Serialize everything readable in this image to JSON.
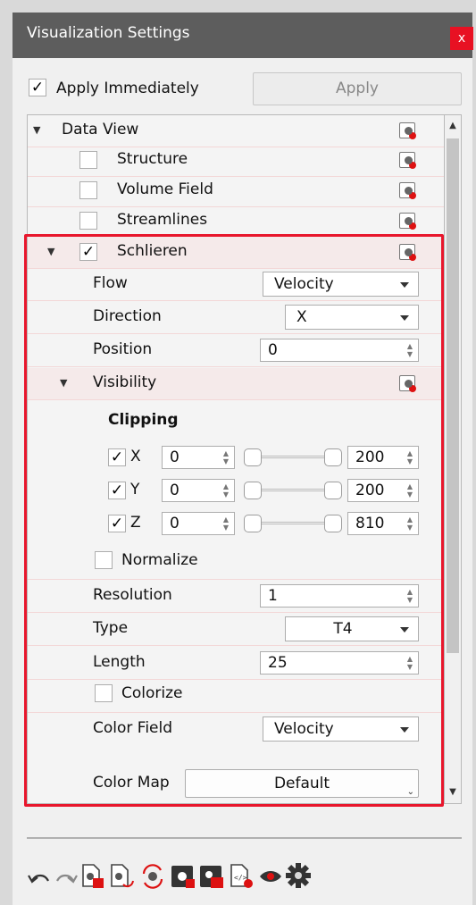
{
  "window": {
    "title": "Visualization Settings",
    "close_label": "x"
  },
  "header": {
    "apply_immediately_label": "Apply Immediately",
    "apply_immediately_checked": true,
    "apply_button_label": "Apply"
  },
  "tree": {
    "data_view_label": "Data View",
    "items": [
      {
        "label": "Structure",
        "checked": false
      },
      {
        "label": "Volume Field",
        "checked": false
      },
      {
        "label": "Streamlines",
        "checked": false
      }
    ],
    "schlieren": {
      "label": "Schlieren",
      "checked": true,
      "flow_label": "Flow",
      "flow_value": "Velocity",
      "direction_label": "Direction",
      "direction_value": "X",
      "position_label": "Position",
      "position_value": "0",
      "visibility_label": "Visibility",
      "clipping_label": "Clipping",
      "clipping": [
        {
          "axis": "X",
          "checked": true,
          "min": "0",
          "max": "200",
          "range": [
            0,
            200
          ],
          "value_low": 0,
          "value_high": 200
        },
        {
          "axis": "Y",
          "checked": true,
          "min": "0",
          "max": "200",
          "range": [
            0,
            200
          ],
          "value_low": 0,
          "value_high": 200
        },
        {
          "axis": "Z",
          "checked": true,
          "min": "0",
          "max": "810",
          "range": [
            0,
            810
          ],
          "value_low": 0,
          "value_high": 810
        }
      ],
      "normalize_label": "Normalize",
      "normalize_checked": false,
      "resolution_label": "Resolution",
      "resolution_value": "1",
      "type_label": "Type",
      "type_value": "T4",
      "length_label": "Length",
      "length_value": "25",
      "colorize_label": "Colorize",
      "colorize_checked": false,
      "color_field_label": "Color Field",
      "color_field_value": "Velocity",
      "color_map_label": "Color Map",
      "color_map_value": "Default"
    }
  },
  "toolbar": {
    "icons": [
      "undo-icon",
      "redo-icon",
      "remove-document-icon",
      "refresh-document-icon",
      "reload-icon",
      "dark-settings-remove-icon",
      "dark-settings-red-icon",
      "code-document-icon",
      "eye-icon",
      "gear-icon"
    ]
  },
  "colors": {
    "titlebar": "#5d5d5d",
    "close_button": "#e81123",
    "highlight_box": "#e8162c"
  }
}
